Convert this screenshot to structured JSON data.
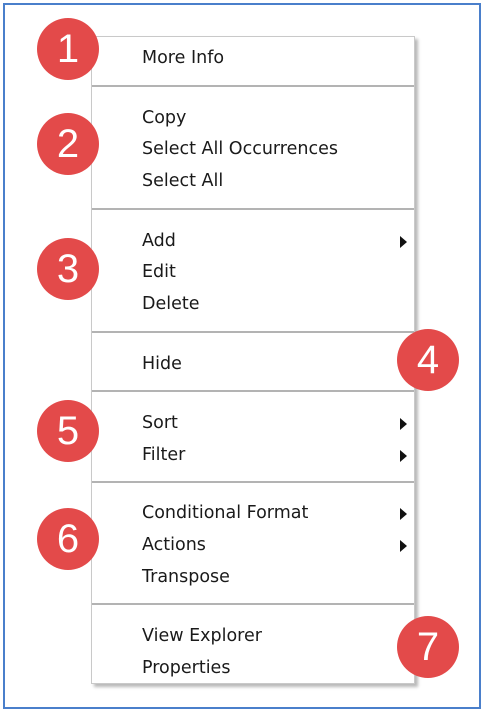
{
  "menu": {
    "sections": [
      {
        "badge": "1",
        "items": [
          {
            "label": "More Info"
          }
        ]
      },
      {
        "badge": "2",
        "items": [
          {
            "label": "Copy"
          },
          {
            "label": "Select All Occurrences"
          },
          {
            "label": "Select All"
          }
        ]
      },
      {
        "badge": "3",
        "items": [
          {
            "label": "Add",
            "submenu": true
          },
          {
            "label": "Edit"
          },
          {
            "label": "Delete"
          }
        ]
      },
      {
        "badge": "4",
        "items": [
          {
            "label": "Hide"
          }
        ]
      },
      {
        "badge": "5",
        "items": [
          {
            "label": "Sort",
            "submenu": true
          },
          {
            "label": "Filter",
            "submenu": true
          }
        ]
      },
      {
        "badge": "6",
        "items": [
          {
            "label": "Conditional Format",
            "submenu": true
          },
          {
            "label": "Actions",
            "submenu": true
          },
          {
            "label": "Transpose"
          }
        ]
      },
      {
        "badge": "7",
        "items": [
          {
            "label": "View Explorer"
          },
          {
            "label": "Properties"
          }
        ]
      }
    ]
  },
  "colors": {
    "badge": "#e34a4a",
    "frame_border": "#4a7fcb"
  }
}
